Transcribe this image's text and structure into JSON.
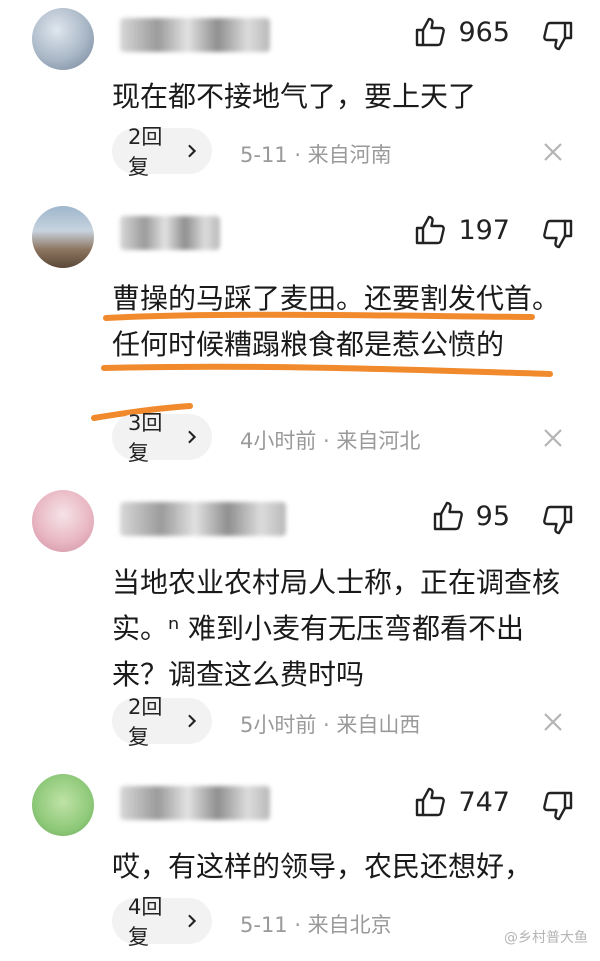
{
  "comments": [
    {
      "likes": "965",
      "text": "现在都不接地气了，要上天了",
      "replies": "2回复",
      "meta": "5-11 · 来自河南"
    },
    {
      "likes": "197",
      "text": "曹操的马踩了麦田。还要割发代首。任何时候糟蹋粮食都是惹公愤的",
      "replies": "3回复",
      "meta": "4小时前 · 来自河北"
    },
    {
      "likes": "95",
      "text": "当地农业农村局人士称，正在调查核实。ⁿ 难到小麦有无压弯都看不出来？调查这么费时吗",
      "replies": "2回复",
      "meta": "5小时前 · 来自山西"
    },
    {
      "likes": "747",
      "text": "哎，有这样的领导，农民还想好，",
      "replies": "4回复",
      "meta": "5-11 · 来自北京"
    }
  ],
  "icons": {
    "like": "thumbs-up-icon",
    "dislike": "thumbs-down-icon",
    "chevron": "chevron-right-icon",
    "close": "close-icon"
  },
  "colors": {
    "highlight": "#f08a2c",
    "meta": "#9a9a9a",
    "reply_bg": "#f2f2f2"
  },
  "watermark": "@乡村普大鱼"
}
